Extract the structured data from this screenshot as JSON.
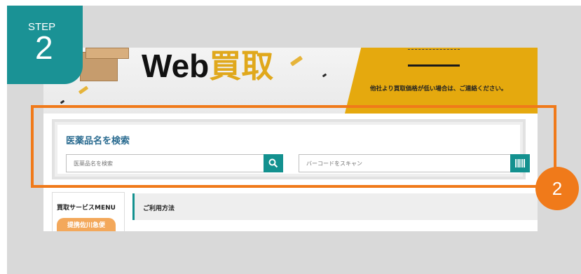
{
  "step": {
    "label": "STEP",
    "number": "2"
  },
  "banner": {
    "title_latin": "Web",
    "title_kanji": "買取",
    "note": "他社より買取価格が低い場合は、ご連絡ください。"
  },
  "search": {
    "heading": "医薬品名を検索",
    "name_placeholder": "医薬品名を検索",
    "barcode_placeholder": "バーコードをスキャン",
    "search_icon": "search-icon",
    "barcode_icon": "barcode-icon"
  },
  "sidebar": {
    "title": "買取サービスMENU",
    "pill_label": "提携佐川急便"
  },
  "howto": {
    "label": "ご利用方法"
  },
  "callout": {
    "number": "2"
  },
  "colors": {
    "teal": "#13918f",
    "orange": "#f07a1a",
    "yellow": "#e5a90e"
  }
}
